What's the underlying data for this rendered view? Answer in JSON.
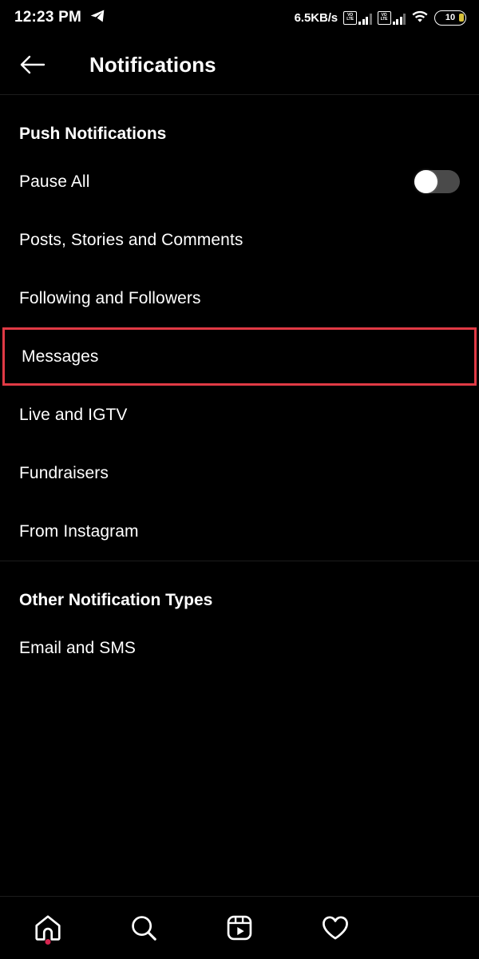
{
  "status_bar": {
    "time": "12:23 PM",
    "send_icon": "paper-plane-icon",
    "network_speed": "6.5KB/s",
    "sim1_label": "VoLTE",
    "sim1_volte_top": "VO",
    "sim1_volte_bottom": "LTE",
    "sim2_volte_top": "VO",
    "sim2_volte_bottom": "LTE",
    "wifi_icon": "wifi-icon",
    "battery_level": "10"
  },
  "header": {
    "back_icon": "arrow-left-icon",
    "title": "Notifications"
  },
  "push_section": {
    "title": "Push Notifications",
    "pause_all": {
      "label": "Pause All",
      "toggle_state": "off"
    },
    "items": [
      {
        "label": "Posts, Stories and Comments",
        "highlighted": false
      },
      {
        "label": "Following and Followers",
        "highlighted": false
      },
      {
        "label": "Messages",
        "highlighted": true
      },
      {
        "label": "Live and IGTV",
        "highlighted": false
      },
      {
        "label": "Fundraisers",
        "highlighted": false
      },
      {
        "label": "From Instagram",
        "highlighted": false
      }
    ]
  },
  "other_section": {
    "title": "Other Notification Types",
    "items": [
      {
        "label": "Email and SMS"
      }
    ]
  },
  "bottom_nav": {
    "items": [
      {
        "icon": "home-icon",
        "badge": true
      },
      {
        "icon": "search-icon",
        "badge": false
      },
      {
        "icon": "reels-icon",
        "badge": false
      },
      {
        "icon": "heart-icon",
        "badge": false
      }
    ]
  },
  "colors": {
    "background": "#000000",
    "highlight_red": "#e03a45",
    "badge_red": "#d6254f",
    "divider": "#1c1c1c",
    "toggle_track": "#4a4a4a",
    "toggle_knob": "#ffffff"
  }
}
